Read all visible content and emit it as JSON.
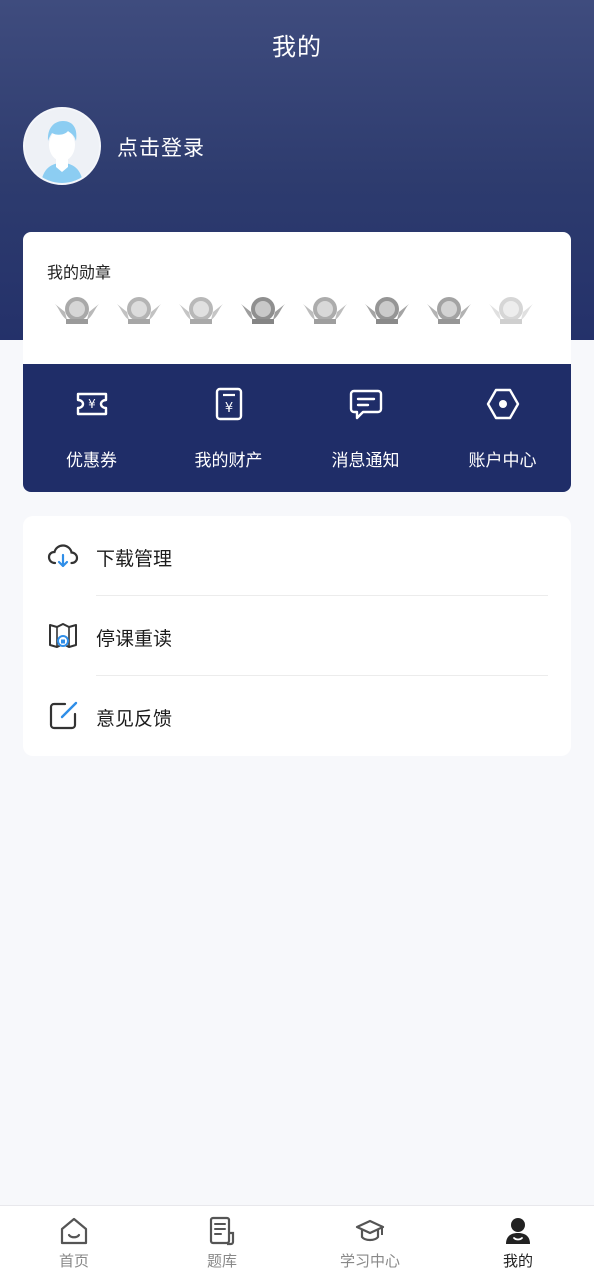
{
  "header": {
    "title": "我的",
    "login_text": "点击登录"
  },
  "medals": {
    "title": "我的勋章",
    "items": [
      {
        "icon": "medal-badge-icon"
      },
      {
        "icon": "medal-badge-icon"
      },
      {
        "icon": "medal-badge-icon"
      },
      {
        "icon": "medal-badge-icon"
      },
      {
        "icon": "medal-badge-icon"
      },
      {
        "icon": "medal-badge-icon"
      },
      {
        "icon": "medal-badge-icon"
      },
      {
        "icon": "medal-badge-icon"
      }
    ]
  },
  "quick_actions": [
    {
      "label": "优惠券",
      "icon": "coupon-icon"
    },
    {
      "label": "我的财产",
      "icon": "wallet-icon"
    },
    {
      "label": "消息通知",
      "icon": "message-icon"
    },
    {
      "label": "账户中心",
      "icon": "hexagon-settings-icon"
    }
  ],
  "menu": [
    {
      "label": "下载管理",
      "icon": "cloud-download-icon"
    },
    {
      "label": "停课重读",
      "icon": "book-lock-icon"
    },
    {
      "label": "意见反馈",
      "icon": "edit-note-icon"
    }
  ],
  "tabbar": [
    {
      "label": "首页",
      "icon": "home-icon",
      "active": false
    },
    {
      "label": "题库",
      "icon": "question-bank-icon",
      "active": false
    },
    {
      "label": "学习中心",
      "icon": "graduation-cap-icon",
      "active": false
    },
    {
      "label": "我的",
      "icon": "user-icon",
      "active": true
    }
  ],
  "colors": {
    "header_top": "#3f4c7e",
    "header_bottom": "#24316a",
    "quick_bar": "#1f2d68",
    "accent_blue": "#2f8ee8",
    "background": "#f7f8fb"
  }
}
